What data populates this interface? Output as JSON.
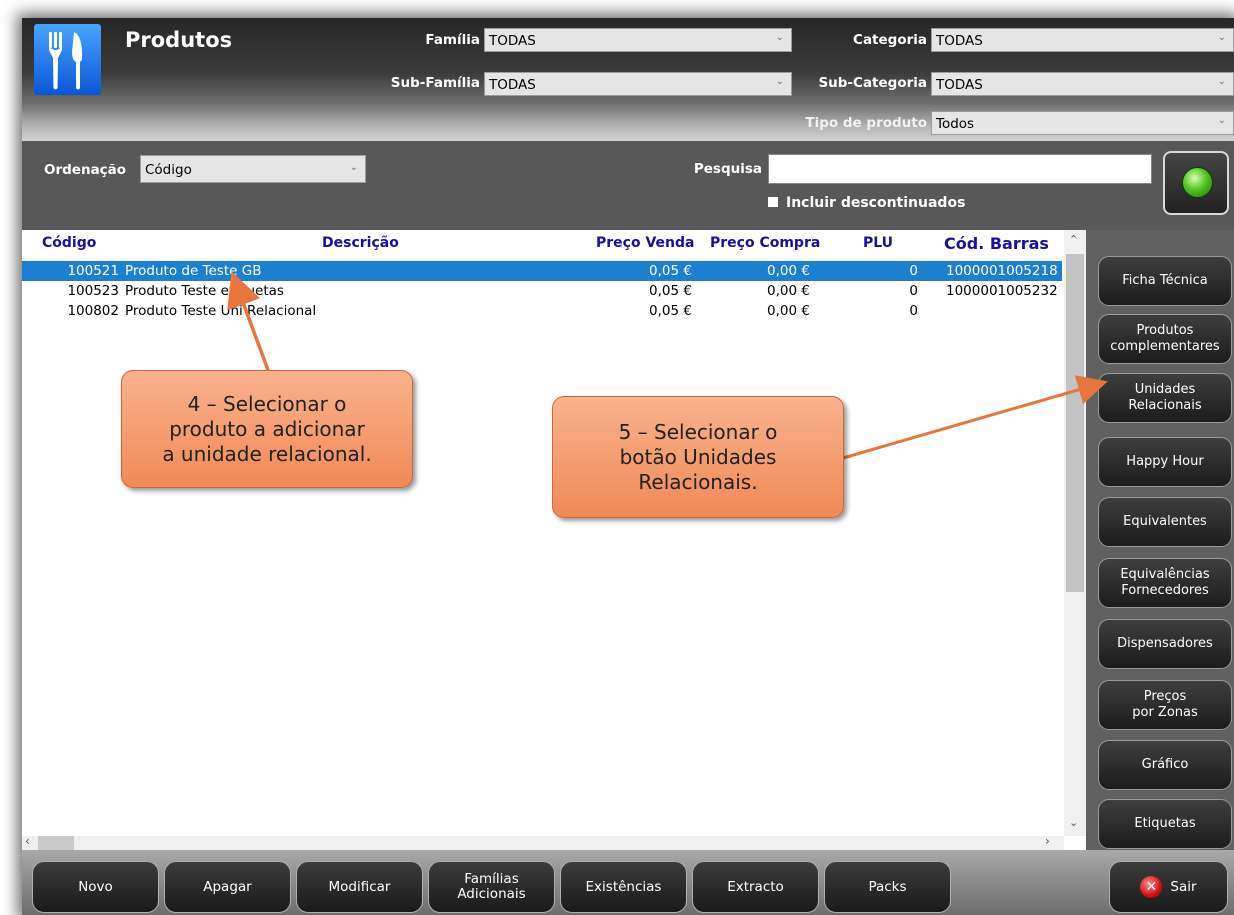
{
  "header": {
    "title": "Produtos",
    "filters": {
      "familia_label": "Família",
      "familia_value": "TODAS",
      "categoria_label": "Categoria",
      "categoria_value": "TODAS",
      "subfamilia_label": "Sub-Família",
      "subfamilia_value": "TODAS",
      "subcategoria_label": "Sub-Categoria",
      "subcategoria_value": "TODAS",
      "tipo_label": "Tipo de produto",
      "tipo_value": "Todos"
    }
  },
  "search": {
    "ordenacao_label": "Ordenação",
    "ordenacao_value": "Código",
    "pesquisa_label": "Pesquisa",
    "pesquisa_value": "",
    "descontinuados_label": "Incluir descontinuados"
  },
  "table": {
    "columns": [
      "Código",
      "Descrição",
      "Preço Venda",
      "Preço Compra",
      "PLU",
      "Cód. Barras"
    ],
    "rows": [
      {
        "codigo": "100521",
        "descricao": "Produto de Teste GB",
        "preco_venda": "0,05 €",
        "preco_compra": "0,00 €",
        "plu": "0",
        "cod_barras": "1000001005218"
      },
      {
        "codigo": "100523",
        "descricao": "Produto Teste etiquetas",
        "preco_venda": "0,05 €",
        "preco_compra": "0,00 €",
        "plu": "0",
        "cod_barras": "1000001005232"
      },
      {
        "codigo": "100802",
        "descricao": "Produto Teste Uni Relacional",
        "preco_venda": "0,05 €",
        "preco_compra": "0,00 €",
        "plu": "0",
        "cod_barras": ""
      }
    ],
    "selected_row": 0
  },
  "side_buttons": [
    "Ficha Técnica",
    "Produtos\ncomplementares",
    "Unidades\nRelacionais",
    "Happy Hour",
    "Equivalentes",
    "Equivalências\nFornecedores",
    "Dispensadores",
    "Preços\npor Zonas",
    "Gráfico",
    "Etiquetas"
  ],
  "footer_buttons": [
    "Novo",
    "Apagar",
    "Modificar",
    "Famílias\nAdicionais",
    "Existências",
    "Extracto",
    "Packs"
  ],
  "exit_label": "Sair",
  "callouts": {
    "step4": "4 – Selecionar o\nproduto a adicionar\na unidade relacional.",
    "step5": "5 – Selecionar o\nbotão Unidades\nRelacionais."
  },
  "colors": {
    "selection": "#1d7fd2",
    "header_text": "#1a0fa0",
    "callout": "#f4996a",
    "arrow": "#e8753c"
  },
  "icons": {
    "app": "cutlery-icon",
    "search": "search-orb-icon",
    "exit": "close-icon"
  }
}
